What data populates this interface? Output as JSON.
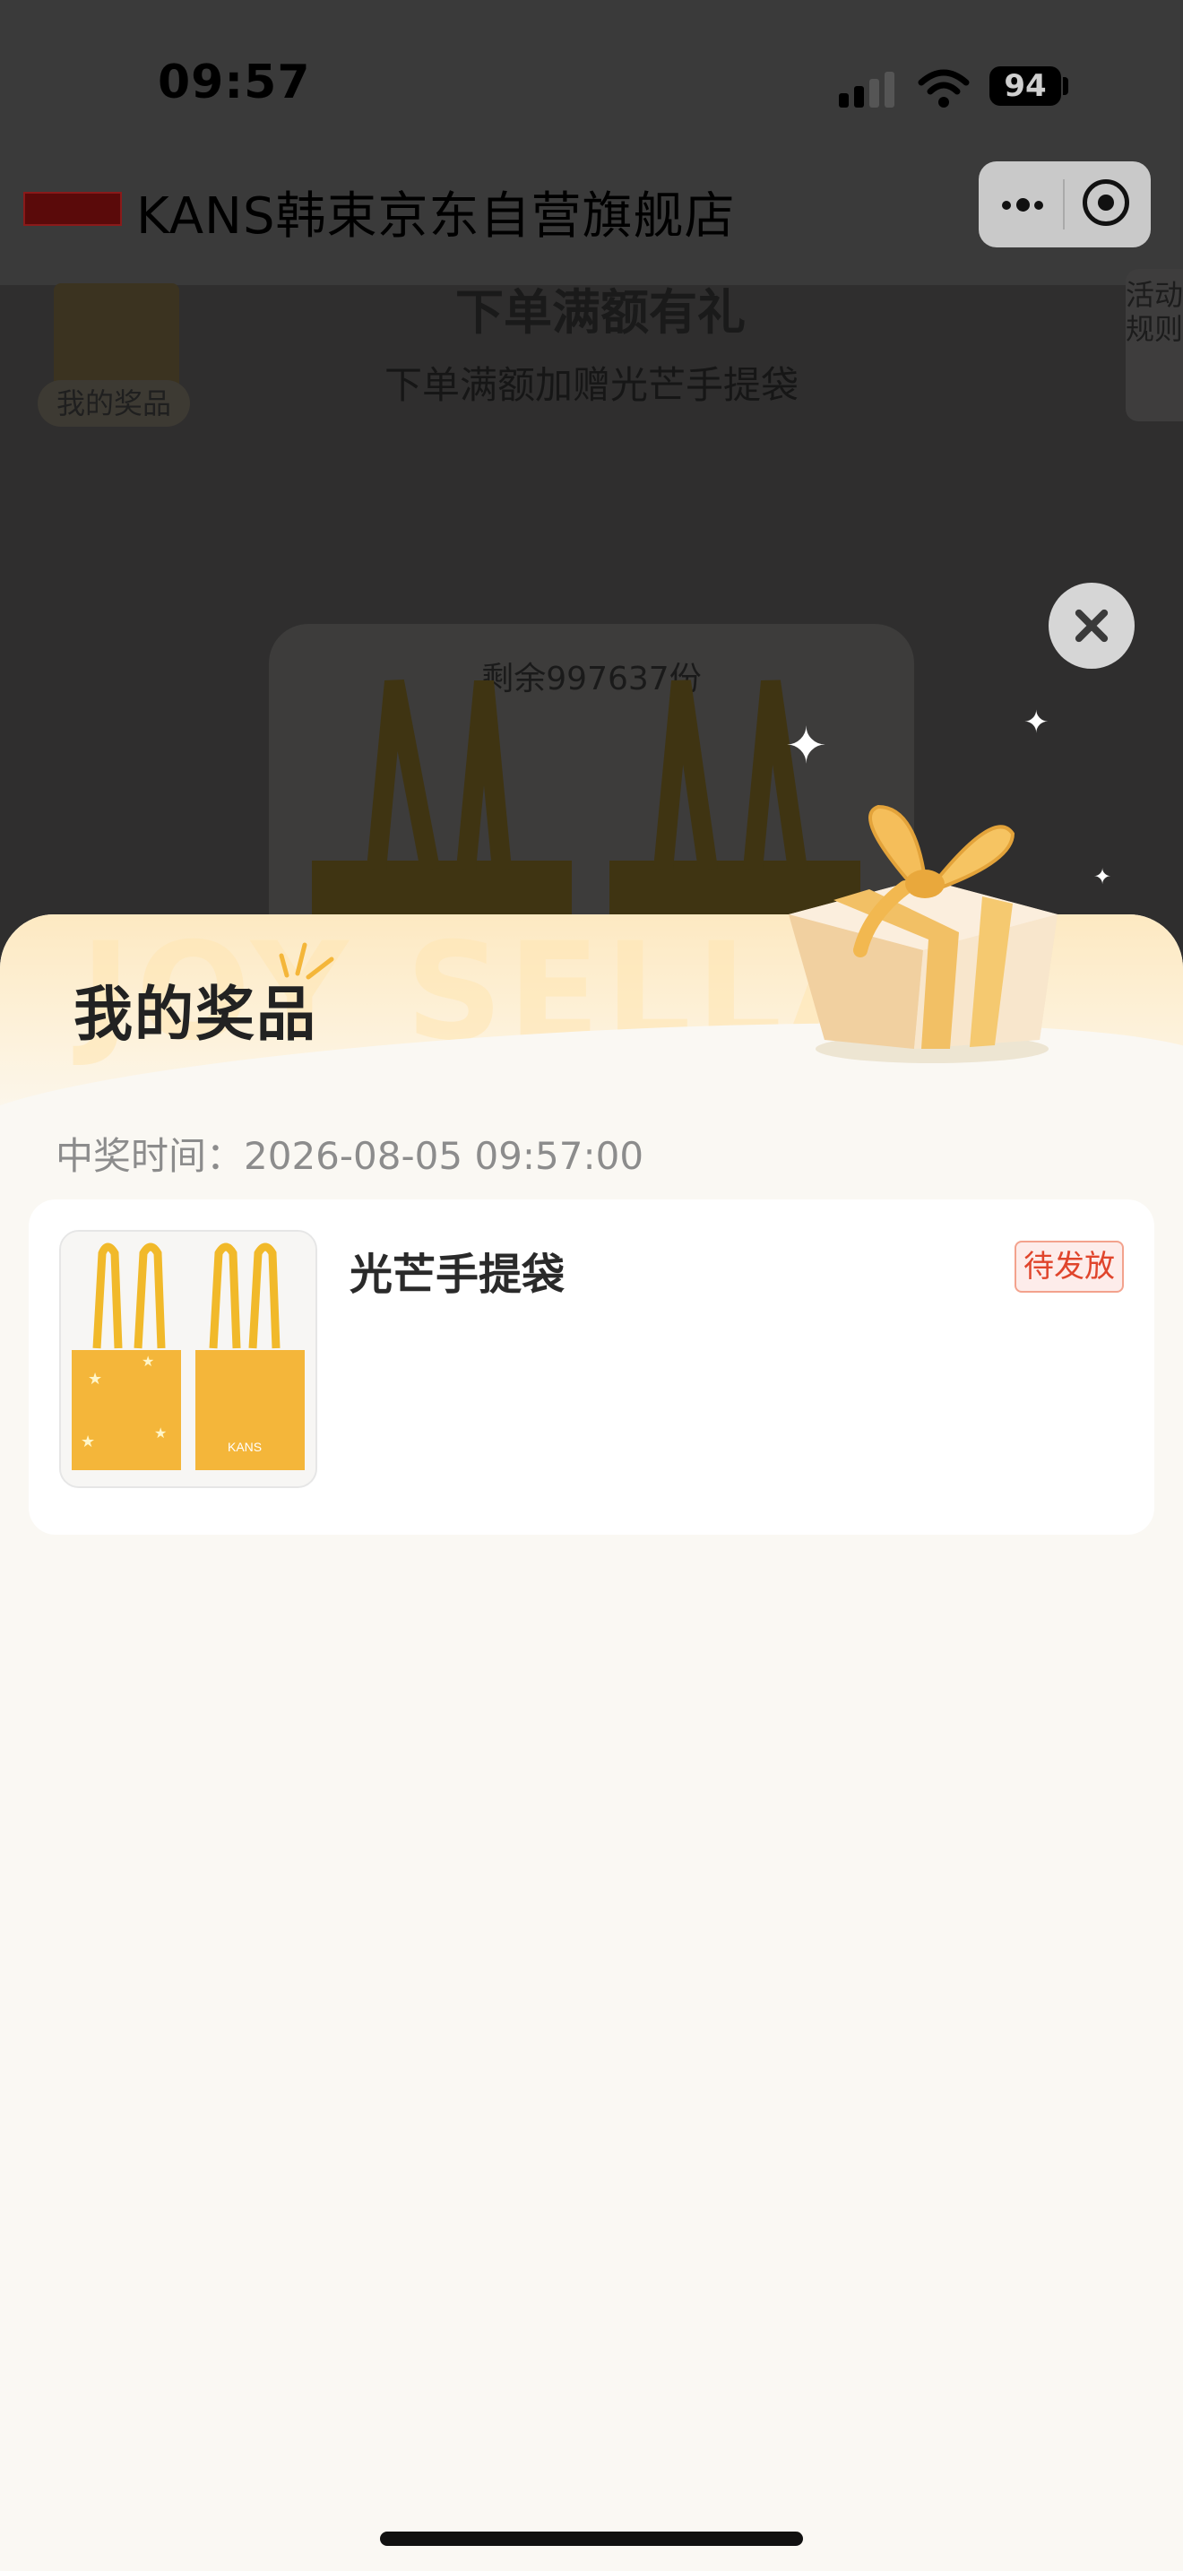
{
  "status_bar": {
    "time": "09:57",
    "battery": "94"
  },
  "nav": {
    "store_title": "KANS韩束京东自营旗舰店"
  },
  "page": {
    "heading": "下单满额有礼",
    "subtitle": "下单满额加赠光芒手提袋",
    "my_prize_tag": "我的奖品",
    "rules_tab": "活动规则",
    "remaining": "剩余997637份"
  },
  "sheet": {
    "title": "我的奖品",
    "watermark": "JOY SELLA",
    "win_time_label": "中奖时间：",
    "win_time_value": "2026-08-05 09:57:00",
    "item": {
      "name": "光芒手提袋",
      "status": "待发放",
      "brand_mark": "KANS"
    }
  },
  "colors": {
    "accent": "#e0452c",
    "gold": "#f4b63a",
    "sheet_bg": "#faf8f3"
  },
  "icons": [
    "signal-icon",
    "wifi-icon",
    "battery-icon",
    "more-icon",
    "target-icon",
    "close-icon",
    "gift-icon",
    "sparkle-icon"
  ]
}
